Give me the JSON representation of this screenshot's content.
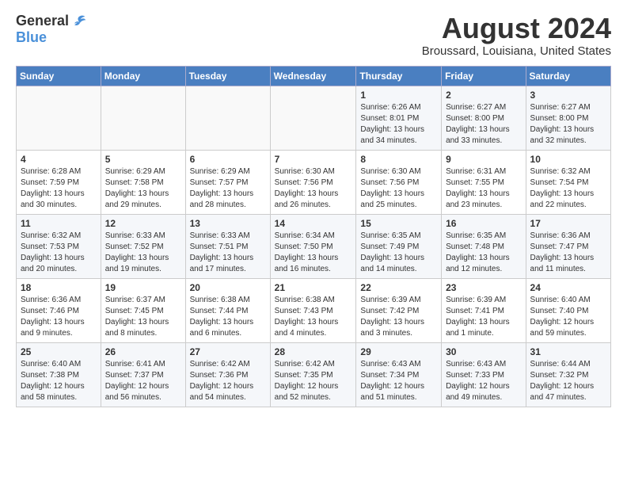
{
  "header": {
    "logo_general": "General",
    "logo_blue": "Blue",
    "month_title": "August 2024",
    "location": "Broussard, Louisiana, United States"
  },
  "days_of_week": [
    "Sunday",
    "Monday",
    "Tuesday",
    "Wednesday",
    "Thursday",
    "Friday",
    "Saturday"
  ],
  "weeks": [
    [
      {
        "day": "",
        "info": ""
      },
      {
        "day": "",
        "info": ""
      },
      {
        "day": "",
        "info": ""
      },
      {
        "day": "",
        "info": ""
      },
      {
        "day": "1",
        "info": "Sunrise: 6:26 AM\nSunset: 8:01 PM\nDaylight: 13 hours and 34 minutes."
      },
      {
        "day": "2",
        "info": "Sunrise: 6:27 AM\nSunset: 8:00 PM\nDaylight: 13 hours and 33 minutes."
      },
      {
        "day": "3",
        "info": "Sunrise: 6:27 AM\nSunset: 8:00 PM\nDaylight: 13 hours and 32 minutes."
      }
    ],
    [
      {
        "day": "4",
        "info": "Sunrise: 6:28 AM\nSunset: 7:59 PM\nDaylight: 13 hours and 30 minutes."
      },
      {
        "day": "5",
        "info": "Sunrise: 6:29 AM\nSunset: 7:58 PM\nDaylight: 13 hours and 29 minutes."
      },
      {
        "day": "6",
        "info": "Sunrise: 6:29 AM\nSunset: 7:57 PM\nDaylight: 13 hours and 28 minutes."
      },
      {
        "day": "7",
        "info": "Sunrise: 6:30 AM\nSunset: 7:56 PM\nDaylight: 13 hours and 26 minutes."
      },
      {
        "day": "8",
        "info": "Sunrise: 6:30 AM\nSunset: 7:56 PM\nDaylight: 13 hours and 25 minutes."
      },
      {
        "day": "9",
        "info": "Sunrise: 6:31 AM\nSunset: 7:55 PM\nDaylight: 13 hours and 23 minutes."
      },
      {
        "day": "10",
        "info": "Sunrise: 6:32 AM\nSunset: 7:54 PM\nDaylight: 13 hours and 22 minutes."
      }
    ],
    [
      {
        "day": "11",
        "info": "Sunrise: 6:32 AM\nSunset: 7:53 PM\nDaylight: 13 hours and 20 minutes."
      },
      {
        "day": "12",
        "info": "Sunrise: 6:33 AM\nSunset: 7:52 PM\nDaylight: 13 hours and 19 minutes."
      },
      {
        "day": "13",
        "info": "Sunrise: 6:33 AM\nSunset: 7:51 PM\nDaylight: 13 hours and 17 minutes."
      },
      {
        "day": "14",
        "info": "Sunrise: 6:34 AM\nSunset: 7:50 PM\nDaylight: 13 hours and 16 minutes."
      },
      {
        "day": "15",
        "info": "Sunrise: 6:35 AM\nSunset: 7:49 PM\nDaylight: 13 hours and 14 minutes."
      },
      {
        "day": "16",
        "info": "Sunrise: 6:35 AM\nSunset: 7:48 PM\nDaylight: 13 hours and 12 minutes."
      },
      {
        "day": "17",
        "info": "Sunrise: 6:36 AM\nSunset: 7:47 PM\nDaylight: 13 hours and 11 minutes."
      }
    ],
    [
      {
        "day": "18",
        "info": "Sunrise: 6:36 AM\nSunset: 7:46 PM\nDaylight: 13 hours and 9 minutes."
      },
      {
        "day": "19",
        "info": "Sunrise: 6:37 AM\nSunset: 7:45 PM\nDaylight: 13 hours and 8 minutes."
      },
      {
        "day": "20",
        "info": "Sunrise: 6:38 AM\nSunset: 7:44 PM\nDaylight: 13 hours and 6 minutes."
      },
      {
        "day": "21",
        "info": "Sunrise: 6:38 AM\nSunset: 7:43 PM\nDaylight: 13 hours and 4 minutes."
      },
      {
        "day": "22",
        "info": "Sunrise: 6:39 AM\nSunset: 7:42 PM\nDaylight: 13 hours and 3 minutes."
      },
      {
        "day": "23",
        "info": "Sunrise: 6:39 AM\nSunset: 7:41 PM\nDaylight: 13 hours and 1 minute."
      },
      {
        "day": "24",
        "info": "Sunrise: 6:40 AM\nSunset: 7:40 PM\nDaylight: 12 hours and 59 minutes."
      }
    ],
    [
      {
        "day": "25",
        "info": "Sunrise: 6:40 AM\nSunset: 7:38 PM\nDaylight: 12 hours and 58 minutes."
      },
      {
        "day": "26",
        "info": "Sunrise: 6:41 AM\nSunset: 7:37 PM\nDaylight: 12 hours and 56 minutes."
      },
      {
        "day": "27",
        "info": "Sunrise: 6:42 AM\nSunset: 7:36 PM\nDaylight: 12 hours and 54 minutes."
      },
      {
        "day": "28",
        "info": "Sunrise: 6:42 AM\nSunset: 7:35 PM\nDaylight: 12 hours and 52 minutes."
      },
      {
        "day": "29",
        "info": "Sunrise: 6:43 AM\nSunset: 7:34 PM\nDaylight: 12 hours and 51 minutes."
      },
      {
        "day": "30",
        "info": "Sunrise: 6:43 AM\nSunset: 7:33 PM\nDaylight: 12 hours and 49 minutes."
      },
      {
        "day": "31",
        "info": "Sunrise: 6:44 AM\nSunset: 7:32 PM\nDaylight: 12 hours and 47 minutes."
      }
    ]
  ]
}
